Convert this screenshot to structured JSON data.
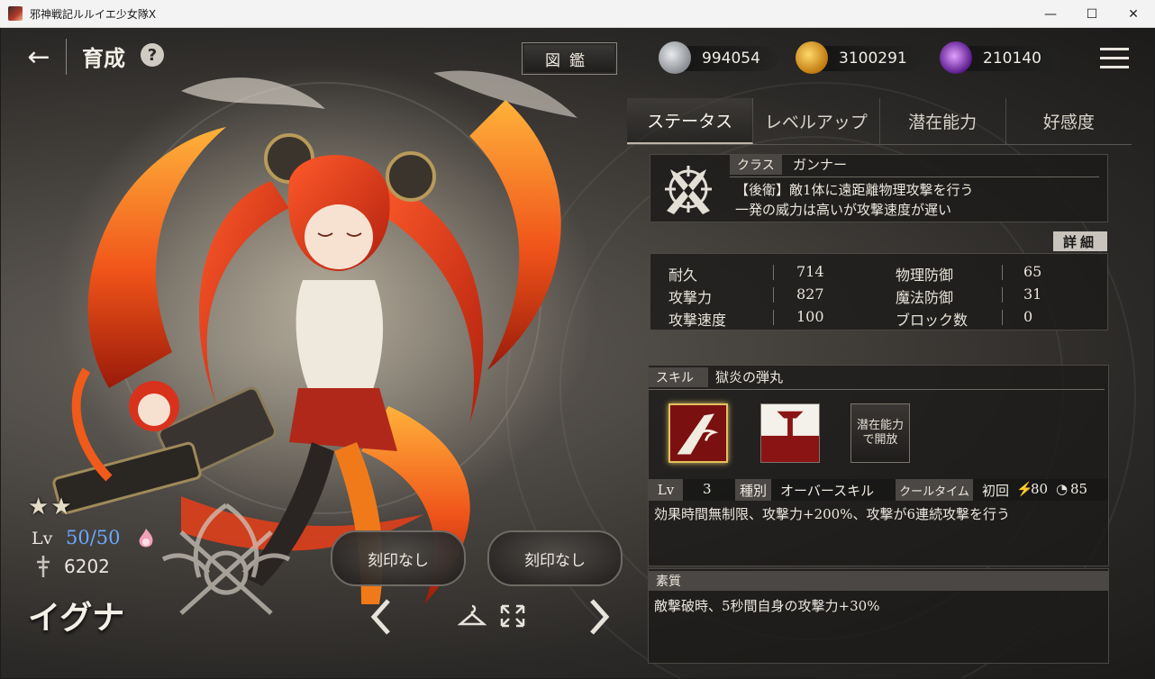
{
  "window": {
    "title": "邪神戦記ルルイエ少女隊X",
    "minimize_glyph": "—",
    "maximize_glyph": "☐",
    "close_glyph": "✕"
  },
  "header": {
    "back_glyph": "←",
    "title": "育成",
    "help_glyph": "?",
    "zukan_label": "図鑑"
  },
  "currencies": [
    {
      "icon": "silver-stone-icon",
      "value": "994054",
      "color": "#b9bcc0"
    },
    {
      "icon": "gold-coin-icon",
      "value": "3100291",
      "color": "#e0a020"
    },
    {
      "icon": "purple-gem-icon",
      "value": "210140",
      "color": "#9a4ad8"
    }
  ],
  "tabs": [
    {
      "label": "ステータス",
      "active": true
    },
    {
      "label": "レベルアップ",
      "active": false
    },
    {
      "label": "潜在能力",
      "active": false
    },
    {
      "label": "好感度",
      "active": false
    }
  ],
  "class_info": {
    "tag": "クラス",
    "value": "ガンナー",
    "desc_line1": "【後衛】敵1体に遠距離物理攻撃を行う",
    "desc_line2": "一発の威力は高いが攻撃速度が遅い",
    "icon": "crossed-guns-icon"
  },
  "detail_button": "詳細",
  "stats": [
    {
      "label": "耐久",
      "value": "714",
      "label2": "物理防御",
      "value2": "65"
    },
    {
      "label": "攻撃力",
      "value": "827",
      "label2": "魔法防御",
      "value2": "31"
    },
    {
      "label": "攻撃速度",
      "value": "100",
      "label2": "ブロック数",
      "value2": "0"
    }
  ],
  "skill": {
    "tag": "スキル",
    "name": "獄炎の弾丸",
    "locked_label_line1": "潜在能力",
    "locked_label_line2": "で開放",
    "lv_tag": "Lv",
    "lv_value": "3",
    "type_tag": "種別",
    "type_value": "オーバースキル",
    "cooldown_tag": "クールタイム",
    "cooldown_first": "初回",
    "cooldown_energy": "80",
    "cooldown_time": "85",
    "description": "効果時間無制限、攻撃力+200%、攻撃が6連続攻撃を行う"
  },
  "trait": {
    "tag": "素質",
    "description": "敵撃破時、5秒間自身の攻撃力+30%"
  },
  "character": {
    "name": "イグナ",
    "lv_label": "Lv",
    "lv_value": "50/50",
    "power": "6202",
    "stars": 2,
    "seal1": "刻印なし",
    "seal2": "刻印なし"
  },
  "colors": {
    "accent_blue": "#6aa9ff",
    "hair_red": "#d8321c",
    "flame_orange": "#f27a1a"
  }
}
